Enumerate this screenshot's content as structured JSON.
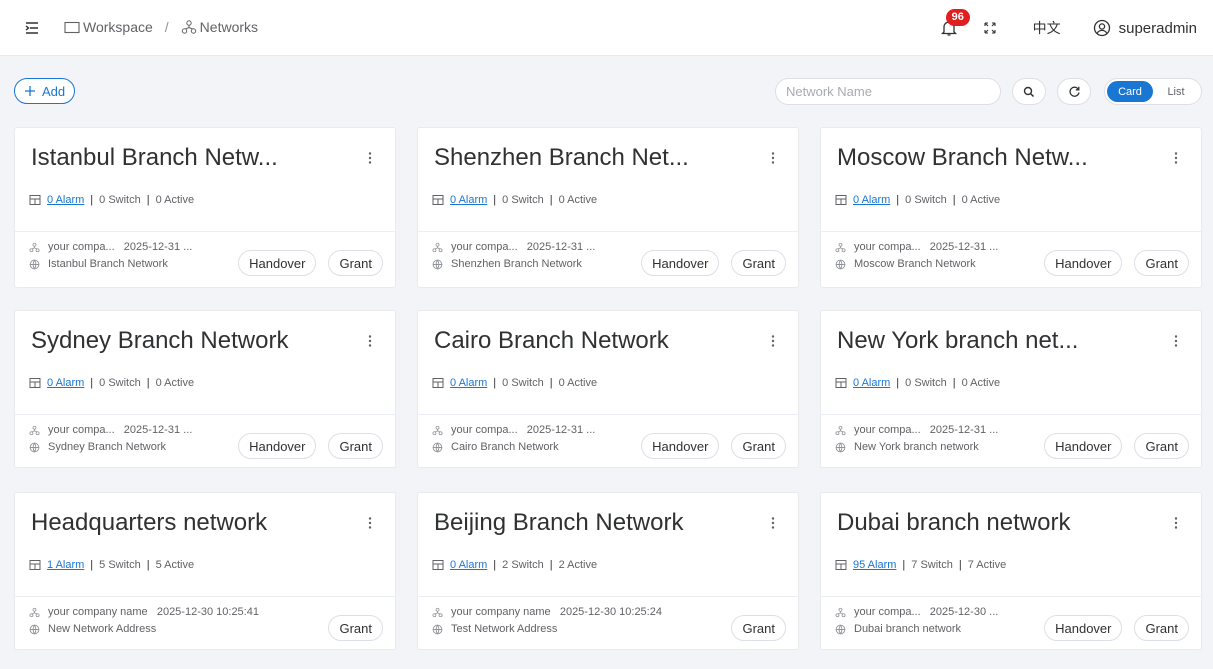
{
  "breadcrumb": {
    "workspace": "Workspace",
    "separator": "/",
    "networks": "Networks"
  },
  "header": {
    "notifications": "96",
    "language": "中文",
    "username": "superadmin"
  },
  "toolbar": {
    "add_label": "Add",
    "search_placeholder": "Network Name",
    "view_card": "Card",
    "view_list": "List"
  },
  "colors": {
    "accent": "#1976d2",
    "badge": "#e02020"
  },
  "cards": [
    {
      "title": "Istanbul Branch Netw...",
      "alarm": "0 Alarm",
      "switch": "0 Switch",
      "active": "0 Active",
      "company": "your compa...   2025-12-31 ...",
      "address": "Istanbul Branch Network",
      "handover": "Handover",
      "grant": "Grant"
    },
    {
      "title": "Shenzhen Branch Net...",
      "alarm": "0 Alarm",
      "switch": "0 Switch",
      "active": "0 Active",
      "company": "your compa...   2025-12-31 ...",
      "address": "Shenzhen Branch Network",
      "handover": "Handover",
      "grant": "Grant"
    },
    {
      "title": "Moscow Branch Netw...",
      "alarm": "0 Alarm",
      "switch": "0 Switch",
      "active": "0 Active",
      "company": "your compa...   2025-12-31 ...",
      "address": "Moscow Branch Network",
      "handover": "Handover",
      "grant": "Grant"
    },
    {
      "title": "Sydney Branch Network",
      "alarm": "0 Alarm",
      "switch": "0 Switch",
      "active": "0 Active",
      "company": "your compa...   2025-12-31 ...",
      "address": "Sydney Branch Network",
      "handover": "Handover",
      "grant": "Grant"
    },
    {
      "title": "Cairo Branch Network",
      "alarm": "0 Alarm",
      "switch": "0 Switch",
      "active": "0 Active",
      "company": "your compa...   2025-12-31 ...",
      "address": "Cairo Branch Network",
      "handover": "Handover",
      "grant": "Grant"
    },
    {
      "title": "New York branch net...",
      "alarm": "0 Alarm",
      "switch": "0 Switch",
      "active": "0 Active",
      "company": "your compa...   2025-12-31 ...",
      "address": "New York branch network",
      "handover": "Handover",
      "grant": "Grant"
    },
    {
      "title": "Headquarters network",
      "alarm": "1 Alarm",
      "switch": "5 Switch",
      "active": "5 Active",
      "company": "your company name   2025-12-30 10:25:41",
      "address": "New Network Address",
      "handover": "",
      "grant": "Grant"
    },
    {
      "title": "Beijing Branch Network",
      "alarm": "0 Alarm",
      "switch": "2 Switch",
      "active": "2 Active",
      "company": "your company name   2025-12-30 10:25:24",
      "address": "Test Network Address",
      "handover": "",
      "grant": "Grant"
    },
    {
      "title": "Dubai branch network",
      "alarm": "95 Alarm",
      "switch": "7 Switch",
      "active": "7 Active",
      "company": "your compa...   2025-12-30 ...",
      "address": "Dubai branch network",
      "handover": "Handover",
      "grant": "Grant"
    }
  ]
}
